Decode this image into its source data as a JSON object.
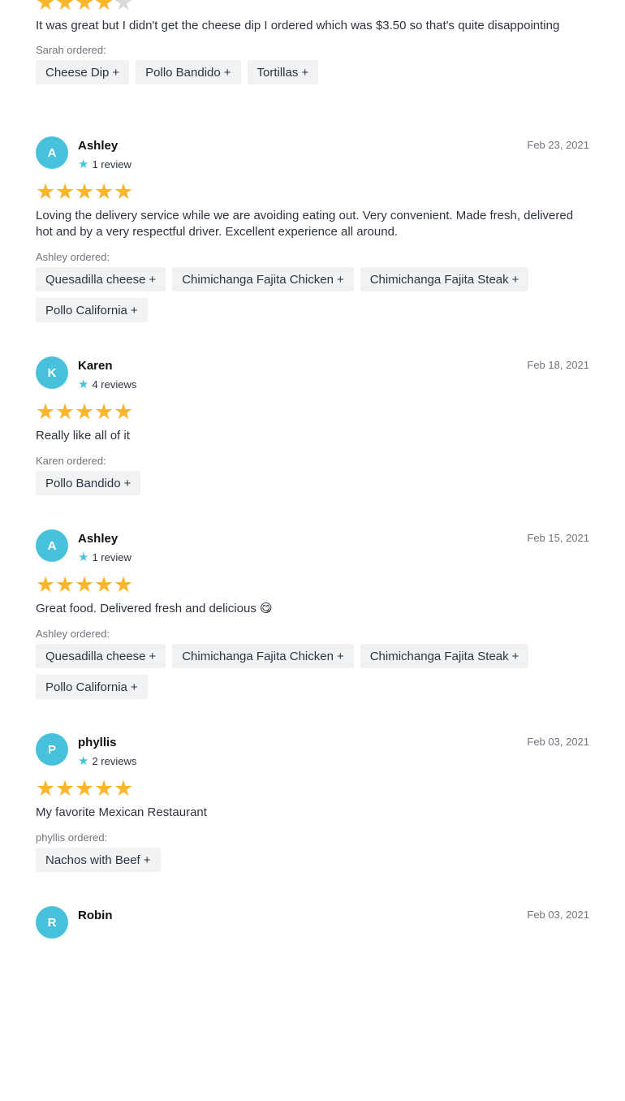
{
  "reviews": [
    {
      "initial": "",
      "name": "",
      "review_count": "",
      "date": "",
      "rating": 4,
      "text": "It was great but I didn't get the cheese dip I ordered which was $3.50 so that's quite disappointing",
      "ordered_label": "Sarah ordered:",
      "items": [
        "Cheese Dip",
        "Pollo Bandido",
        "Tortillas"
      ],
      "partial_top": true
    },
    {
      "initial": "A",
      "name": "Ashley",
      "review_count": "1 review",
      "date": "Feb 23, 2021",
      "rating": 5,
      "text": "Loving the delivery service while we are avoiding eating out. Very convenient. Made fresh, delivered hot and by a very respectful driver. Excellent experience all around.",
      "ordered_label": "Ashley ordered:",
      "items": [
        "Quesadilla cheese",
        "Chimichanga Fajita Chicken",
        "Chimichanga Fajita Steak",
        "Pollo California"
      ]
    },
    {
      "initial": "K",
      "name": "Karen",
      "review_count": "4 reviews",
      "date": "Feb 18, 2021",
      "rating": 5,
      "text": "Really like all of it",
      "ordered_label": "Karen ordered:",
      "items": [
        "Pollo Bandido"
      ]
    },
    {
      "initial": "A",
      "name": "Ashley",
      "review_count": "1 review",
      "date": "Feb 15, 2021",
      "rating": 5,
      "text": "Great food. Delivered fresh and delicious 😋",
      "ordered_label": "Ashley ordered:",
      "items": [
        "Quesadilla cheese",
        "Chimichanga Fajita Chicken",
        "Chimichanga Fajita Steak",
        "Pollo California"
      ]
    },
    {
      "initial": "P",
      "name": "phyllis",
      "review_count": "2 reviews",
      "date": "Feb 03, 2021",
      "rating": 5,
      "text": "My favorite Mexican Restaurant",
      "ordered_label": "phyllis ordered:",
      "items": [
        "Nachos with Beef"
      ]
    },
    {
      "initial": "R",
      "name": "Robin",
      "review_count": "",
      "date": "Feb 03, 2021",
      "rating": 0,
      "text": "",
      "ordered_label": "",
      "items": []
    }
  ],
  "icons": {
    "star": "star-icon",
    "plus": "plus-icon",
    "review_count_star": "star-icon"
  },
  "colors": {
    "star_on": "#f9b62b",
    "star_off": "#d8d9db",
    "avatar": "#48c2dc",
    "chip_bg": "#f1f2f4"
  }
}
